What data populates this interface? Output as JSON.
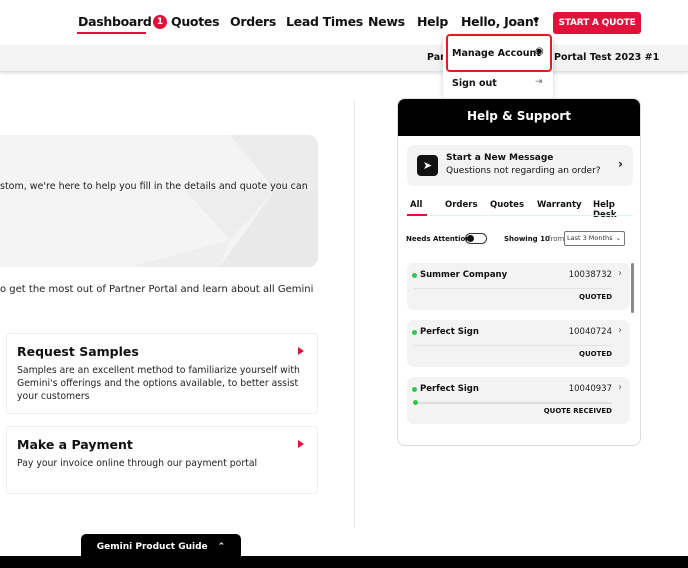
{
  "nav": {
    "items": [
      "Dashboard",
      "Quotes",
      "Orders",
      "Lead Times",
      "News",
      "Help"
    ],
    "quotes_badge": "1",
    "greeting": "Hello, Joan!",
    "cta": "START A QUOTE"
  },
  "subbar": {
    "left_fragment": "Par",
    "right_fragment": "Portal Test 2023 #1"
  },
  "account_menu": {
    "items": [
      {
        "label": "Manage Account",
        "icon": "user-circle-icon"
      },
      {
        "label": "Sign out",
        "icon": "sign-out-icon"
      }
    ]
  },
  "main": {
    "hero_text": "stom, we're here to help you fill in the details and quote you can",
    "intro_text": "o get the most out of Partner Portal and learn about all Gemini",
    "cards": [
      {
        "title": "Request Samples",
        "body": "Samples are an excellent method to familiarize yourself with Gemini's offerings and the options available, to better assist your customers"
      },
      {
        "title": "Make a Payment",
        "body": "Pay your invoice online through our payment portal"
      }
    ]
  },
  "help": {
    "title": "Help & Support",
    "new_message": {
      "title": "Start a New Message",
      "subtitle": "Questions not regarding an order?"
    },
    "tabs": [
      "All",
      "Orders",
      "Quotes",
      "Warranty",
      "Help Desk"
    ],
    "active_tab": "All",
    "needs_attention": "Needs Attention",
    "needs_attention_on": false,
    "showing_label": "Showing 10",
    "showing_from": "from",
    "range": "Last 3 Months",
    "items": [
      {
        "name": "Summer Company",
        "number": "10038732",
        "status": "QUOTED"
      },
      {
        "name": "Perfect Sign",
        "number": "10040724",
        "status": "QUOTED"
      },
      {
        "name": "Perfect Sign",
        "number": "10040937",
        "status": "QUOTE RECEIVED"
      }
    ]
  },
  "footer": {
    "guide": "Gemini Product Guide"
  },
  "colors": {
    "accent": "#e0123c",
    "status_dot": "#2ec84a",
    "highlight": "#e01e1e"
  }
}
